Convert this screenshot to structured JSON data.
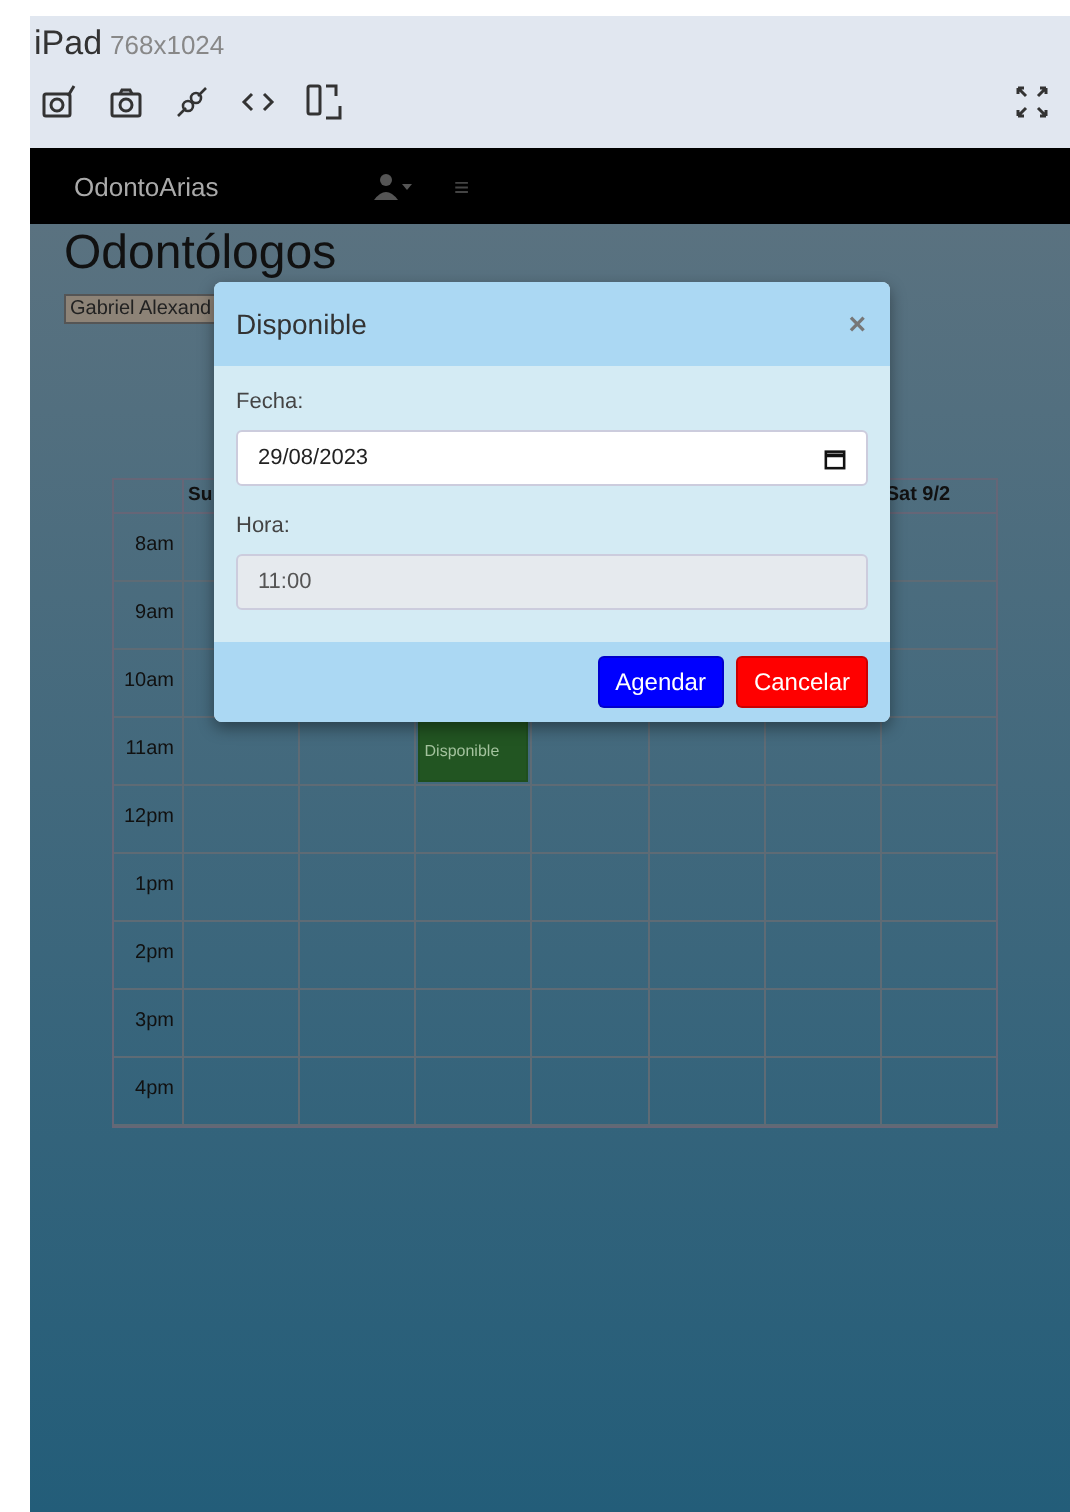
{
  "device": {
    "name": "iPad",
    "size": "768x1024"
  },
  "navbar": {
    "brand": "OdontoArias",
    "menu_glyph": "≡"
  },
  "page": {
    "title": "Odontólogos",
    "dentist_select": "Gabriel Alexand"
  },
  "calendar": {
    "day_headers": [
      "Su",
      "Sat 9/2"
    ],
    "hours": [
      "8am",
      "9am",
      "10am",
      "11am",
      "12pm",
      "1pm",
      "2pm",
      "3pm",
      "4pm"
    ],
    "events": [
      {
        "label": "Disponible",
        "color": "#225522"
      }
    ]
  },
  "modal": {
    "title": "Disponible",
    "close": "×",
    "fields": [
      {
        "label": "Fecha:",
        "value": "29/08/2023",
        "kind": "date",
        "disabled": false
      },
      {
        "label": "Hora:",
        "value": "11:00",
        "kind": "text",
        "disabled": true
      }
    ],
    "buttons": [
      {
        "label": "Agendar",
        "kind": "primary"
      },
      {
        "label": "Cancelar",
        "kind": "danger"
      }
    ]
  }
}
